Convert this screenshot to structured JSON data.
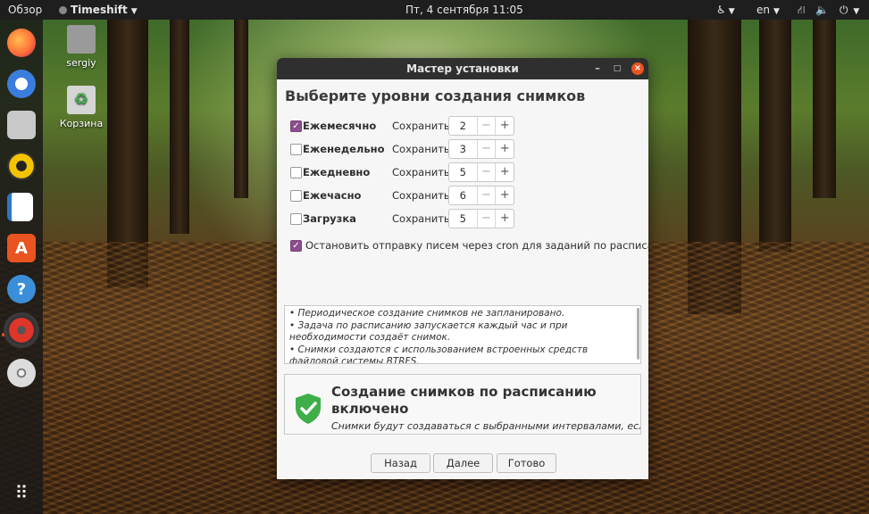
{
  "topbar": {
    "activities": "Обзор",
    "app_menu": "Timeshift",
    "clock": "Пт, 4 сентября  11:05",
    "keyboard_layout": "en"
  },
  "desktop": {
    "home_label": "sergiy",
    "trash_label": "Корзина"
  },
  "dock": {
    "items": [
      "firefox-icon",
      "thunderbird-icon",
      "files-icon",
      "rhythmbox-icon",
      "writer-icon",
      "software-icon",
      "help-icon",
      "timeshift-icon",
      "dvd-icon",
      "show-apps-icon"
    ]
  },
  "window": {
    "title": "Мастер установки",
    "heading": "Выберите уровни создания снимков",
    "levels": [
      {
        "label": "Ежемесячно",
        "checked": true,
        "keep_label": "Сохранить",
        "count": "2"
      },
      {
        "label": "Еженедельно",
        "checked": false,
        "keep_label": "Сохранить",
        "count": "3"
      },
      {
        "label": "Ежедневно",
        "checked": false,
        "keep_label": "Сохранить",
        "count": "5"
      },
      {
        "label": "Ежечасно",
        "checked": false,
        "keep_label": "Сохранить",
        "count": "6"
      },
      {
        "label": "Загрузка",
        "checked": false,
        "keep_label": "Сохранить",
        "count": "5"
      }
    ],
    "cron_option": {
      "label": "Остановить отправку писем через cron для заданий по расписанию",
      "checked": true
    },
    "notes": [
      "• Периодическое создание снимков не запланировано.",
      "• Задача по расписанию запускается каждый час и при необходимости создаёт снимок.",
      "• Снимки создаются с использованием встроенных средств файловой системы BTRFS."
    ],
    "status": {
      "title": "Создание снимков по расписанию включено",
      "subtitle": "Снимки будут создаваться с выбранными интервалами, если"
    },
    "buttons": {
      "back": "Назад",
      "next": "Далее",
      "finish": "Готово"
    },
    "colors": {
      "accent": "#8a4f8c",
      "close": "#e95420",
      "shield": "#3fae49"
    }
  }
}
